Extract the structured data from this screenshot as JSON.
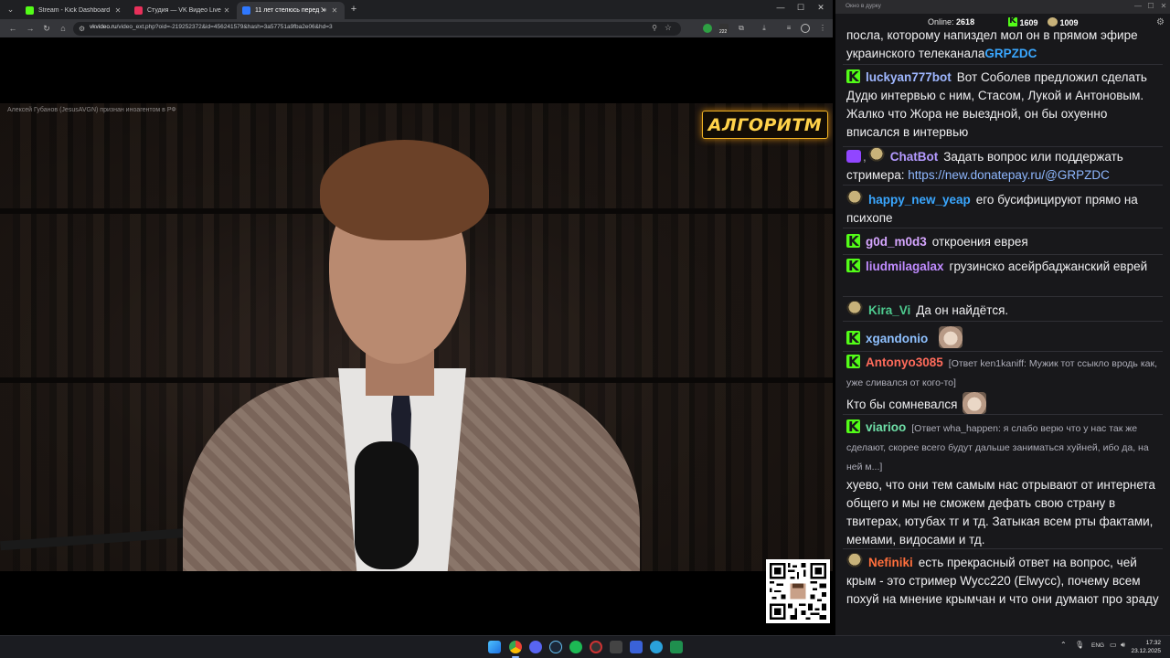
{
  "browser": {
    "tabs": [
      {
        "title": "Stream - Kick Dashboard",
        "favicon_color": "#53fc18",
        "active": false
      },
      {
        "title": "Студия — VK Видео Live",
        "favicon_color": "#e8305a",
        "active": false
      },
      {
        "title": "11 лет стелюсь перед Укр",
        "favicon_color": "#2f78ff",
        "active": true
      }
    ],
    "new_tab": "+",
    "url_domain": "vkvideo.ru",
    "url_path": "/video_ext.php?oid=-219252372&id=456241579&hash=3a57751a9fba2e06&hd=3",
    "ext_badge": "222"
  },
  "video": {
    "ticker": "Алексей Губанов (JesusAVGN) признан иноагентом в РФ",
    "logo_text": "АЛГОРИТМ"
  },
  "chat": {
    "window_title": "Окно в дурку",
    "online_label": "Online:",
    "online_value": "2618",
    "kick_count": "1609",
    "other_count": "1009",
    "messages": [
      {
        "user": "",
        "color": "#efeff1",
        "text": "посла, которому напиздел мол он в прямом эфире украинского телеканала",
        "tail": "GRPZDC"
      },
      {
        "user": "luckyan777bot",
        "color": "#9fb7ff",
        "text": "Вот Соболев предложил сделать Дудю интервью с ним, Стасом, Лукой и Антоновым. Жалко что Жора не выездной, он бы охуенно вписался в интервью"
      },
      {
        "user": "ChatBot",
        "color": "#b49aff",
        "text": "Задать вопрос или поддержать стримера: ",
        "link": "https://new.donatepay.ru/@GRPZDC"
      },
      {
        "user": "happy_new_yeap",
        "color": "#3aa7ff",
        "text": "его бусифицируют прямо на психопе"
      },
      {
        "user": "g0d_m0d3",
        "color": "#d6a6ff",
        "text": "откроения еврея"
      },
      {
        "user": "liudmilagalax",
        "color": "#c08bff",
        "text": "грузинско асейрбаджанский еврей"
      },
      {
        "user": "Kira_Vi",
        "color": "#4ecb8f",
        "text": "Да он найдётся."
      },
      {
        "user": "xgandonio",
        "color": "#8fc1ff",
        "text": ""
      },
      {
        "user": "Antonyo3085",
        "color": "#ff6b5b",
        "reply": "[Ответ ken1kaniff: Мужик тот ссыкло вродь как, уже сливался от кого-то]",
        "text": "Кто бы сомневался"
      },
      {
        "user": "viarioo",
        "color": "#6fe0a8",
        "reply": "[Ответ wha_happen: я слабо верю что у нас так же сделают, скорее всего будут дальше заниматься хуйней, ибо да, на ней м...]",
        "text": "хуево, что они тем самым нас отрывают от интернета общего и мы не сможем дефать свою страну в твитерах, ютубах тг и тд. Затыкая всем рты фактами, мемами, видосами и тд."
      },
      {
        "user": "Nefiniki",
        "color": "#ff6f3c",
        "text": "есть прекрасный ответ на вопрос, чей крым - это стример Wycc220 (Elwycc), почему всем похуй на мнение крымчан и что они думают про зраду"
      }
    ]
  },
  "taskbar": {
    "lang": "ENG",
    "time": "17:32",
    "date": "23.12.2025"
  },
  "icons": {
    "back": "back-arrow-icon",
    "forward": "forward-arrow-icon",
    "reload": "reload-icon",
    "home": "home-icon",
    "search": "search-icon",
    "star": "bookmark-star-icon",
    "gear": "gear-icon"
  }
}
